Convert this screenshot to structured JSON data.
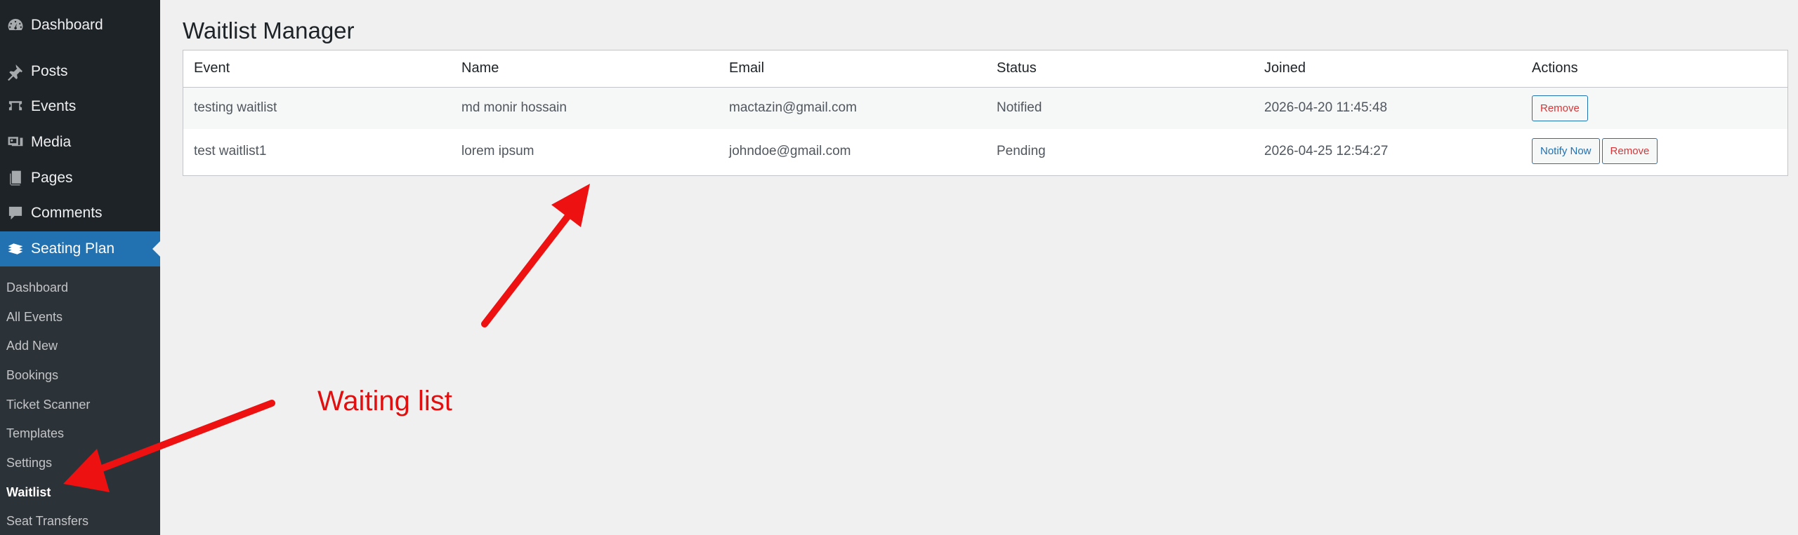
{
  "sidebar": {
    "menu": [
      {
        "label": "Dashboard",
        "icon": "dashboard-icon"
      },
      {
        "label": "Posts",
        "icon": "pushpin-icon"
      },
      {
        "label": "Events",
        "icon": "tickets-icon"
      },
      {
        "label": "Media",
        "icon": "media-icon"
      },
      {
        "label": "Pages",
        "icon": "pages-icon"
      },
      {
        "label": "Comments",
        "icon": "comment-bubble-icon"
      },
      {
        "label": "Seating Plan",
        "icon": "seating-plan-icon"
      }
    ],
    "submenu": [
      "Dashboard",
      "All Events",
      "Add New",
      "Bookings",
      "Ticket Scanner",
      "Templates",
      "Settings",
      "Waitlist",
      "Seat Transfers"
    ],
    "current_submenu": "Waitlist"
  },
  "page": {
    "title": "Waitlist Manager"
  },
  "table": {
    "headers": [
      "Event",
      "Name",
      "Email",
      "Status",
      "Joined",
      "Actions"
    ],
    "rows": [
      {
        "event": "testing waitlist",
        "name": "md monir hossain",
        "email": "mactazin@gmail.com",
        "status": "Notified",
        "joined": "2026-04-20 11:45:48",
        "actions": [
          "Remove"
        ]
      },
      {
        "event": "test waitlist1",
        "name": "lorem ipsum",
        "email": "johndoe@gmail.com",
        "status": "Pending",
        "joined": "2026-04-25 12:54:27",
        "actions": [
          "Notify Now",
          "Remove"
        ]
      }
    ]
  },
  "annotation": {
    "label": "Waiting list",
    "color": "#e01010"
  },
  "colors": {
    "sidebar_bg": "#1d2327",
    "submenu_bg": "#2c3338",
    "active_menu_bg": "#2271b1",
    "page_bg": "#f0f0f1",
    "remove_text": "#d63638",
    "button_border": "#2271b1"
  }
}
